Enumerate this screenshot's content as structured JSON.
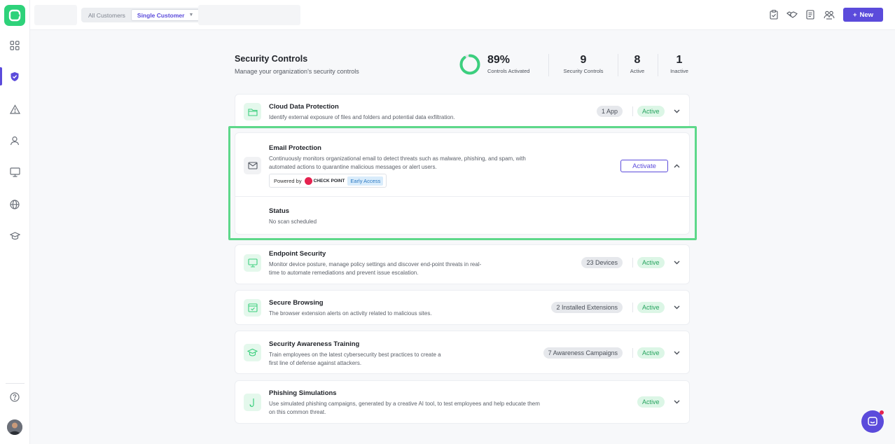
{
  "topbar": {
    "segment_all": "All Customers",
    "segment_single": "Single Customer",
    "new_label": "New"
  },
  "header": {
    "title": "Security Controls",
    "subtitle": "Manage your organization's security controls",
    "stats": [
      {
        "value": "89%",
        "label": "Controls Activated",
        "fraction": 0.89
      },
      {
        "value": "9",
        "label": "Security Controls"
      },
      {
        "value": "8",
        "label": "Active"
      },
      {
        "value": "1",
        "label": "Inactive"
      }
    ]
  },
  "controls": {
    "cloud": {
      "title": "Cloud Data Protection",
      "desc": "Identify external exposure of files and folders and potential data exfiltration.",
      "count": "1 App",
      "status": "Active"
    },
    "email": {
      "title": "Email Protection",
      "desc1": "Continuously monitors organizational email to detect threats such as malware, phishing, and spam, with",
      "desc2": "automated actions to quarantine malicious messages or alert users.",
      "powered_by": "Powered by",
      "partner": "CHECK POINT",
      "badge": "Early Access",
      "action": "Activate",
      "status_title": "Status",
      "status_value": "No scan scheduled"
    },
    "endpoint": {
      "title": "Endpoint Security",
      "desc1": "Monitor device posture, manage policy settings and discover end-point threats in real-",
      "desc2": "time to automate remediations and prevent issue escalation.",
      "count": "23 Devices",
      "status": "Active"
    },
    "browsing": {
      "title": "Secure Browsing",
      "desc": "The browser extension alerts on activity related to malicious sites.",
      "count": "2 Installed Extensions",
      "status": "Active"
    },
    "training": {
      "title": "Security Awareness Training",
      "desc1": "Train employees on the latest cybersecurity best practices to create a",
      "desc2": "first line of defense against attackers.",
      "count": "7 Awareness Campaigns",
      "status": "Active"
    },
    "phishing": {
      "title": "Phishing Simulations",
      "desc1": "Use simulated phishing campaigns, generated by a creative AI tool, to test employees and help educate them",
      "desc2": "on this common threat.",
      "status": "Active"
    }
  },
  "colors": {
    "accent": "#5b4bdb",
    "active_green": "#27a35f",
    "highlight": "#5ed88a"
  }
}
